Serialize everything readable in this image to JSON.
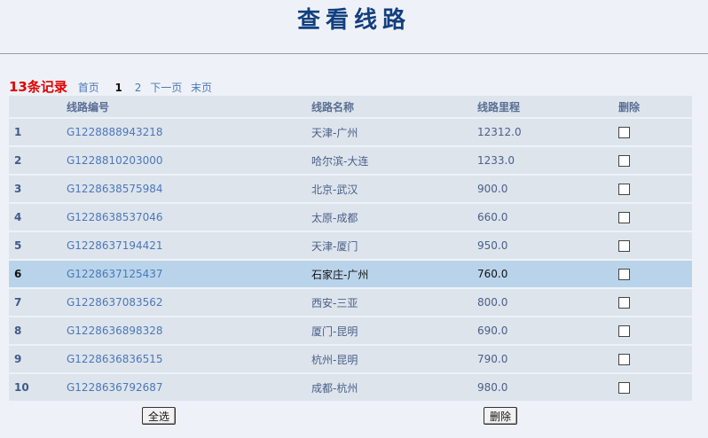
{
  "page": {
    "title": "查看线路"
  },
  "pager": {
    "count_text": "13条记录",
    "first": "首页",
    "current": "1",
    "next_page_num": "2",
    "next": "下一页",
    "last": "末页"
  },
  "table": {
    "headers": {
      "index": "",
      "code": "线路编号",
      "name": "线路名称",
      "mileage": "线路里程",
      "delete": "删除"
    },
    "rows": [
      {
        "index": "1",
        "code": "G1228888943218",
        "name": "天津-广州",
        "mileage": "12312.0",
        "selected": false
      },
      {
        "index": "2",
        "code": "G1228810203000",
        "name": "哈尔滨-大连",
        "mileage": "1233.0",
        "selected": false
      },
      {
        "index": "3",
        "code": "G1228638575984",
        "name": "北京-武汉",
        "mileage": "900.0",
        "selected": false
      },
      {
        "index": "4",
        "code": "G1228638537046",
        "name": "太原-成都",
        "mileage": "660.0",
        "selected": false
      },
      {
        "index": "5",
        "code": "G1228637194421",
        "name": "天津-厦门",
        "mileage": "950.0",
        "selected": false
      },
      {
        "index": "6",
        "code": "G1228637125437",
        "name": "石家庄-广州",
        "mileage": "760.0",
        "selected": true
      },
      {
        "index": "7",
        "code": "G1228637083562",
        "name": "西安-三亚",
        "mileage": "800.0",
        "selected": false
      },
      {
        "index": "8",
        "code": "G1228636898328",
        "name": "厦门-昆明",
        "mileage": "690.0",
        "selected": false
      },
      {
        "index": "9",
        "code": "G1228636836515",
        "name": "杭州-昆明",
        "mileage": "790.0",
        "selected": false
      },
      {
        "index": "10",
        "code": "G1228636792687",
        "name": "成都-杭州",
        "mileage": "980.0",
        "selected": false
      }
    ]
  },
  "actions": {
    "select_all": "全选",
    "delete": "删除"
  },
  "colors": {
    "title": "#123f7f",
    "count": "#e00000",
    "link": "#4d77b8",
    "row_bg": "#dde4ec",
    "selected_row_bg": "#b9d4ea",
    "page_bg": "#eef2f8"
  }
}
